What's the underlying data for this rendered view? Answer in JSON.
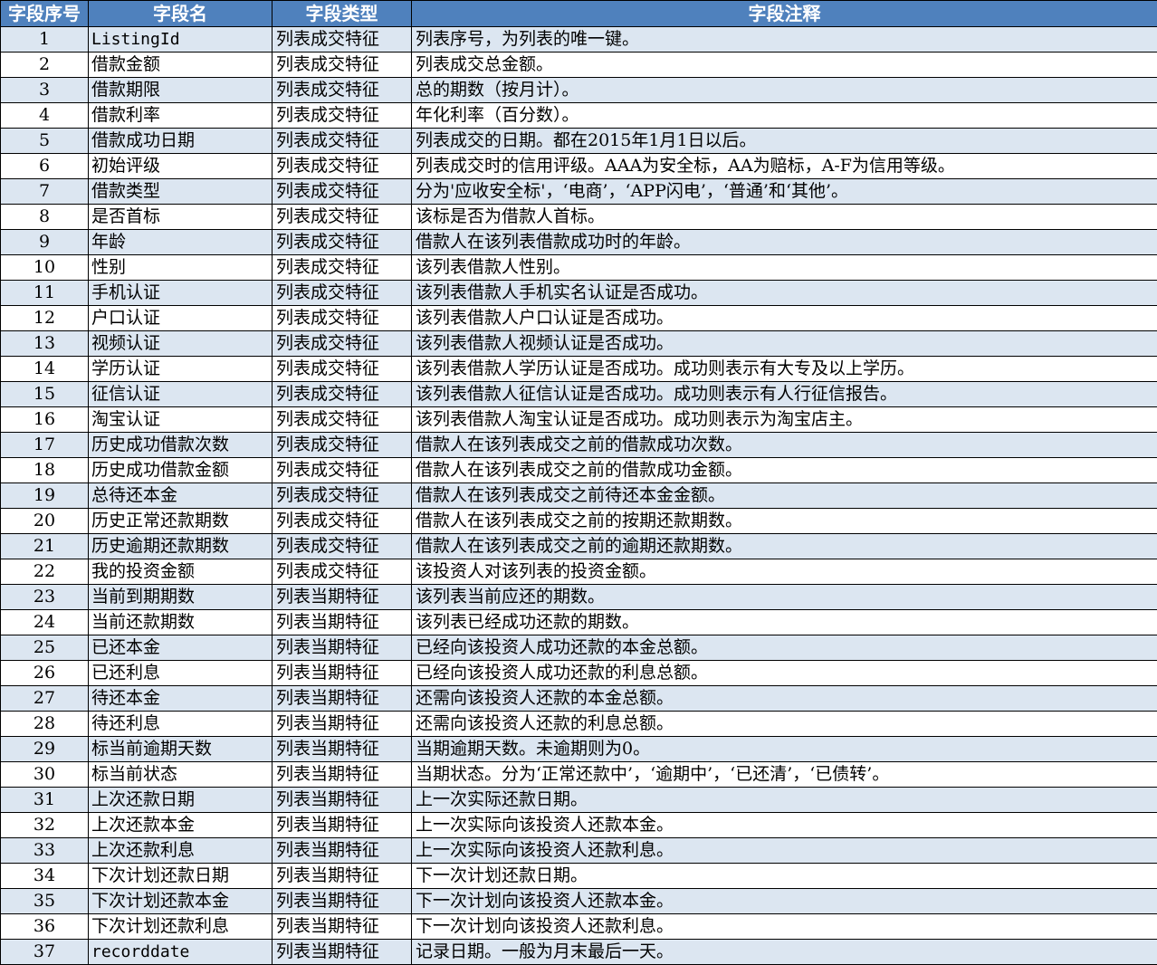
{
  "headers": [
    "字段序号",
    "字段名",
    "字段类型",
    "字段注释"
  ],
  "rows": [
    {
      "no": "1",
      "name": "ListingId",
      "type": "列表成交特征",
      "note": "列表序号，为列表的唯一键。"
    },
    {
      "no": "2",
      "name": "借款金额",
      "type": "列表成交特征",
      "note": "列表成交总金额。"
    },
    {
      "no": "3",
      "name": "借款期限",
      "type": "列表成交特征",
      "note": "总的期数（按月计）。"
    },
    {
      "no": "4",
      "name": "借款利率",
      "type": "列表成交特征",
      "note": "年化利率（百分数）。"
    },
    {
      "no": "5",
      "name": "借款成功日期",
      "type": "列表成交特征",
      "note": "列表成交的日期。都在2015年1月1日以后。"
    },
    {
      "no": "6",
      "name": "初始评级",
      "type": "列表成交特征",
      "note": "列表成交时的信用评级。AAA为安全标，AA为赔标，A-F为信用等级。"
    },
    {
      "no": "7",
      "name": "借款类型",
      "type": "列表成交特征",
      "note": "分为'应收安全标'，‘电商’，‘APP闪电’，‘普通’和‘其他’。"
    },
    {
      "no": "8",
      "name": "是否首标",
      "type": "列表成交特征",
      "note": "该标是否为借款人首标。"
    },
    {
      "no": "9",
      "name": "年龄",
      "type": "列表成交特征",
      "note": "借款人在该列表借款成功时的年龄。"
    },
    {
      "no": "10",
      "name": "性别",
      "type": "列表成交特征",
      "note": "该列表借款人性别。"
    },
    {
      "no": "11",
      "name": "手机认证",
      "type": "列表成交特征",
      "note": "该列表借款人手机实名认证是否成功。"
    },
    {
      "no": "12",
      "name": "户口认证",
      "type": "列表成交特征",
      "note": "该列表借款人户口认证是否成功。"
    },
    {
      "no": "13",
      "name": "视频认证",
      "type": "列表成交特征",
      "note": "该列表借款人视频认证是否成功。"
    },
    {
      "no": "14",
      "name": "学历认证",
      "type": "列表成交特征",
      "note": "该列表借款人学历认证是否成功。成功则表示有大专及以上学历。"
    },
    {
      "no": "15",
      "name": "征信认证",
      "type": "列表成交特征",
      "note": "该列表借款人征信认证是否成功。成功则表示有人行征信报告。"
    },
    {
      "no": "16",
      "name": "淘宝认证",
      "type": "列表成交特征",
      "note": "该列表借款人淘宝认证是否成功。成功则表示为淘宝店主。"
    },
    {
      "no": "17",
      "name": "历史成功借款次数",
      "type": "列表成交特征",
      "note": "借款人在该列表成交之前的借款成功次数。"
    },
    {
      "no": "18",
      "name": "历史成功借款金额",
      "type": "列表成交特征",
      "note": "借款人在该列表成交之前的借款成功金额。"
    },
    {
      "no": "19",
      "name": "总待还本金",
      "type": "列表成交特征",
      "note": "借款人在该列表成交之前待还本金金额。"
    },
    {
      "no": "20",
      "name": "历史正常还款期数",
      "type": "列表成交特征",
      "note": "借款人在该列表成交之前的按期还款期数。"
    },
    {
      "no": "21",
      "name": "历史逾期还款期数",
      "type": "列表成交特征",
      "note": "借款人在该列表成交之前的逾期还款期数。"
    },
    {
      "no": "22",
      "name": "我的投资金额",
      "type": "列表成交特征",
      "note": "该投资人对该列表的投资金额。"
    },
    {
      "no": "23",
      "name": "当前到期期数",
      "type": "列表当期特征",
      "note": "该列表当前应还的期数。"
    },
    {
      "no": "24",
      "name": "当前还款期数",
      "type": "列表当期特征",
      "note": "该列表已经成功还款的期数。"
    },
    {
      "no": "25",
      "name": "已还本金",
      "type": "列表当期特征",
      "note": "已经向该投资人成功还款的本金总额。"
    },
    {
      "no": "26",
      "name": "已还利息",
      "type": "列表当期特征",
      "note": "已经向该投资人成功还款的利息总额。"
    },
    {
      "no": "27",
      "name": "待还本金",
      "type": "列表当期特征",
      "note": "还需向该投资人还款的本金总额。"
    },
    {
      "no": "28",
      "name": "待还利息",
      "type": "列表当期特征",
      "note": "还需向该投资人还款的利息总额。"
    },
    {
      "no": "29",
      "name": "标当前逾期天数",
      "type": "列表当期特征",
      "note": "当期逾期天数。未逾期则为0。"
    },
    {
      "no": "30",
      "name": "标当前状态",
      "type": "列表当期特征",
      "note": "当期状态。分为‘正常还款中’，‘逾期中’，‘已还清’，‘已债转’。"
    },
    {
      "no": "31",
      "name": "上次还款日期",
      "type": "列表当期特征",
      "note": "上一次实际还款日期。"
    },
    {
      "no": "32",
      "name": "上次还款本金",
      "type": "列表当期特征",
      "note": "上一次实际向该投资人还款本金。"
    },
    {
      "no": "33",
      "name": "上次还款利息",
      "type": "列表当期特征",
      "note": "上一次实际向该投资人还款利息。"
    },
    {
      "no": "34",
      "name": "下次计划还款日期",
      "type": "列表当期特征",
      "note": "下一次计划还款日期。"
    },
    {
      "no": "35",
      "name": "下次计划还款本金",
      "type": "列表当期特征",
      "note": "下一次计划向该投资人还款本金。"
    },
    {
      "no": "36",
      "name": "下次计划还款利息",
      "type": "列表当期特征",
      "note": "下一次计划向该投资人还款利息。"
    },
    {
      "no": "37",
      "name": "recorddate",
      "type": "列表当期特征",
      "note": "记录日期。一般为月末最后一天。"
    }
  ],
  "colors": {
    "header_bg": "#4f81bd",
    "header_text": "#ffffff",
    "band_bg": "#dce6f1",
    "row_bg": "#ffffff",
    "grid": "#000000"
  }
}
